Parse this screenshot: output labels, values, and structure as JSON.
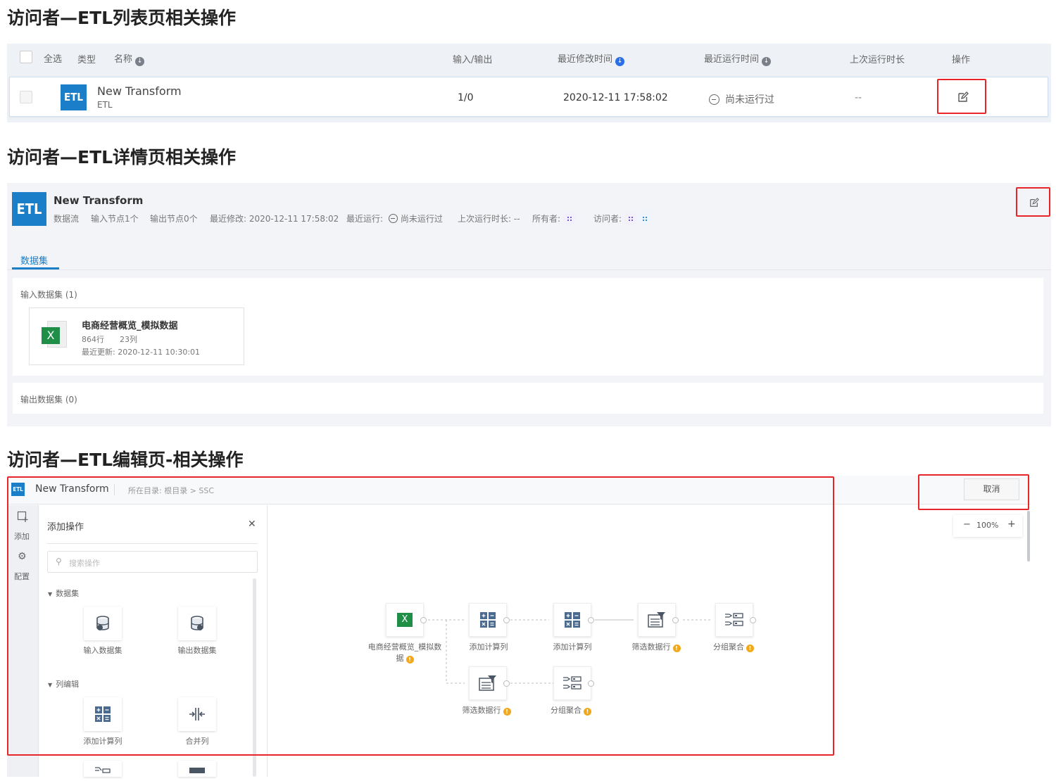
{
  "sections": {
    "list_title": "访问者—ETL列表页相关操作",
    "detail_title": "访问者—ETL详情页相关操作",
    "edit_title": "访问者—ETL编辑页-相关操作"
  },
  "list": {
    "header": {
      "select_all": "全选",
      "type": "类型",
      "name": "名称",
      "io": "输入/输出",
      "modified": "最近修改时间",
      "last_run": "最近运行时间",
      "duration": "上次运行时长",
      "action": "操作"
    },
    "row": {
      "logo": "ETL",
      "name": "New Transform",
      "subtype": "ETL",
      "io": "1/0",
      "modified": "2020-12-11 17:58:02",
      "last_run": "尚未运行过",
      "duration": "--"
    }
  },
  "detail": {
    "logo": "ETL",
    "title": "New Transform",
    "meta": {
      "kind": "数据流",
      "inputs": "输入节点1个",
      "outputs": "输出节点0个",
      "modified": "最近修改: 2020-12-11 17:58:02",
      "last_run_label": "最近运行:",
      "last_run_value": "尚未运行过",
      "duration": "上次运行时长: --",
      "owner_label": "所有者:",
      "visitor_label": "访问者:"
    },
    "tab": "数据集",
    "input_header": "输入数据集 (1)",
    "dataset": {
      "name": "电商经营概览_模拟数据",
      "rows": "864行",
      "cols": "23列",
      "updated": "最近更新: 2020-12-11 10:30:01"
    },
    "output_header": "输出数据集 (0)"
  },
  "editor": {
    "logo": "ETL",
    "title": "New Transform",
    "breadcrumb": "所在目录: 根目录 > SSC",
    "cancel": "取消",
    "zoom": "100%",
    "zoom_minus": "−",
    "zoom_plus": "+",
    "rail": {
      "add": "添加",
      "config": "配置"
    },
    "panel": {
      "title": "添加操作",
      "close": "✕",
      "search_placeholder": "搜索操作",
      "group_dataset": "数据集",
      "group_column": "列编辑",
      "op_input": "输入数据集",
      "op_output": "输出数据集",
      "op_calc": "添加计算列",
      "op_merge": "合并列"
    },
    "nodes": {
      "source_line1": "电商经营概览_模拟数",
      "source_line2": "据",
      "calc1": "添加计算列",
      "calc2": "添加计算列",
      "filter1": "筛选数据行",
      "group1": "分组聚合",
      "filter2": "筛选数据行",
      "group2": "分组聚合",
      "warn": "!"
    }
  },
  "colors": {
    "accent": "#1a7ec8",
    "highlight": "#e8262a",
    "excel": "#1f8f48",
    "warning": "#f2a81b"
  }
}
